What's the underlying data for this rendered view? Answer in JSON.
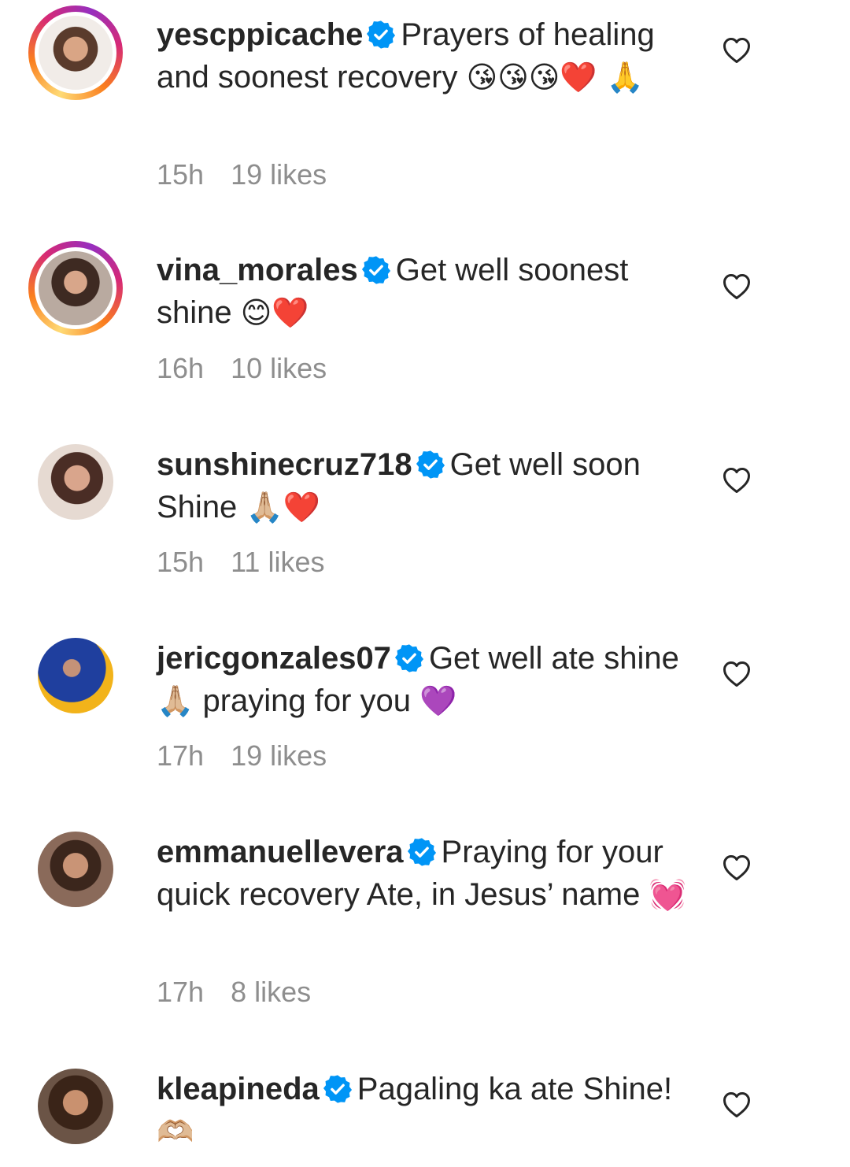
{
  "comments": [
    {
      "username": "yescppicache",
      "text": "Prayers of healing and soonest recovery",
      "emoji": "😘😘😘❤️ 🙏",
      "time": "15h",
      "likes": "19 likes",
      "story_ring": true
    },
    {
      "username": "vina_morales",
      "text": "Get well soonest shine",
      "emoji": "😊❤️",
      "time": "16h",
      "likes": "10 likes",
      "story_ring": true
    },
    {
      "username": "sunshinecruz718",
      "text": "Get well soon Shine",
      "emoji": "🙏🏼❤️",
      "time": "15h",
      "likes": "11 likes",
      "story_ring": false
    },
    {
      "username": "jericgonzales07",
      "text": "Get well ate shine",
      "emoji": "🙏🏼",
      "text2": "praying for you",
      "emoji2": "💜",
      "time": "17h",
      "likes": "19 likes",
      "story_ring": false
    },
    {
      "username": "emmanuellevera",
      "text": "Praying for your quick recovery Ate, in Jesus’ name",
      "emoji": "💓",
      "time": "17h",
      "likes": "8 likes",
      "story_ring": false
    },
    {
      "username": "kleapineda",
      "text": "Pagaling ka ate Shine!",
      "emoji": "🫶🏼",
      "story_ring": false
    }
  ],
  "colors": {
    "text": "#262626",
    "meta": "#8e8e8e",
    "verified_badge": "#0095f6"
  },
  "icons": {
    "verified": "verified-badge-icon",
    "like": "heart-outline-icon"
  }
}
